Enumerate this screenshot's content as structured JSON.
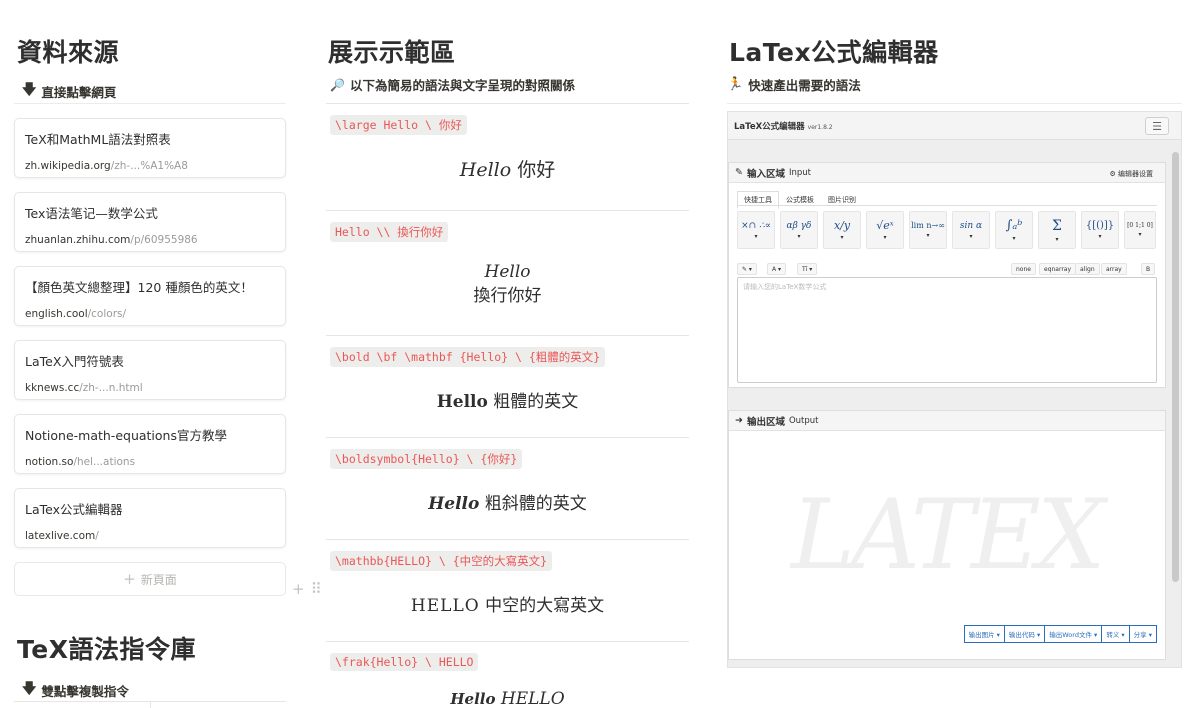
{
  "sources": {
    "title": "資料來源",
    "subtitle": "直接點擊網頁",
    "cards": [
      {
        "title": "TeX和MathML語法對照表",
        "domain": "zh.wikipedia.org",
        "path": "/zh-...%A1%A8"
      },
      {
        "title": "Tex语法笔记—数学公式",
        "domain": "zhuanlan.zhihu.com",
        "path": "/p/60955986"
      },
      {
        "title": "【顏色英文總整理】120 種顏色的英文！",
        "domain": "english.cool",
        "path": "/colors/"
      },
      {
        "title": "LaTeX入門符號表",
        "domain": "kknews.cc",
        "path": "/zh-...n.html"
      },
      {
        "title": "Notione-math-equations官方教學",
        "domain": "notion.so",
        "path": "/hel...ations"
      },
      {
        "title": "LaTex公式編輯器",
        "domain": "latexlive.com",
        "path": "/"
      }
    ],
    "new_page": "新頁面"
  },
  "library": {
    "title": "TeX語法指令庫",
    "subtitle": "雙點擊複製指令"
  },
  "demo": {
    "title": "展示示範區",
    "subtitle": "以下為簡易的語法與文字呈現的對照關係",
    "blocks": [
      {
        "code": "\\large Hello \\ 你好",
        "render_en": "Hello",
        "render_zh": "你好"
      },
      {
        "code": "Hello \\\\ 換行你好",
        "render_en": "Hello",
        "render_zh": "換行你好"
      },
      {
        "code": "\\bold \\bf \\mathbf {Hello} \\ {粗體的英文}",
        "render_en": "Hello",
        "render_zh": "粗體的英文"
      },
      {
        "code": "\\boldsymbol{Hello} \\ {你好}",
        "render_en": "Hello",
        "render_zh": "粗斜體的英文"
      },
      {
        "code": "\\mathbb{HELLO} \\ {中空的大寫英文}",
        "render_en": "HELLO",
        "render_zh": "中空的大寫英文"
      },
      {
        "code": "\\frak{Hello} \\ HELLO",
        "render_en": "Hello",
        "render_zh": "HELLO"
      }
    ]
  },
  "editor": {
    "title": "LaTex公式編輯器",
    "subtitle": "快速產出需要的語法",
    "app_title": "LaTeX公式编辑器",
    "version": "ver1.8.2",
    "input_title": "输入区域",
    "input_en": "Input",
    "settings_label": "编辑器设置",
    "tabs": [
      "快捷工具",
      "公式模板",
      "图片识别"
    ],
    "symbols": [
      "×∩ ∴∝",
      "αβ γδ",
      "x/y",
      "√eˣ",
      "lim n→∞",
      "sin α",
      "∫ₐᵇ",
      "Σ",
      "{[()]}",
      "[0 1;1 0]"
    ],
    "format_left": [
      "✎ ▾",
      "A ▾",
      "Tī ▾"
    ],
    "format_right": [
      "none",
      "eqnarray",
      "align",
      "array",
      "B"
    ],
    "placeholder": "请输入您的LaTeX数学公式",
    "output_title": "输出区域",
    "output_en": "Output",
    "watermark": "LATEX",
    "output_buttons": [
      "输出图片 ▾",
      "输出代码 ▾",
      "输出Word文件 ▾",
      "转义 ▾",
      "分享 ▾"
    ]
  }
}
